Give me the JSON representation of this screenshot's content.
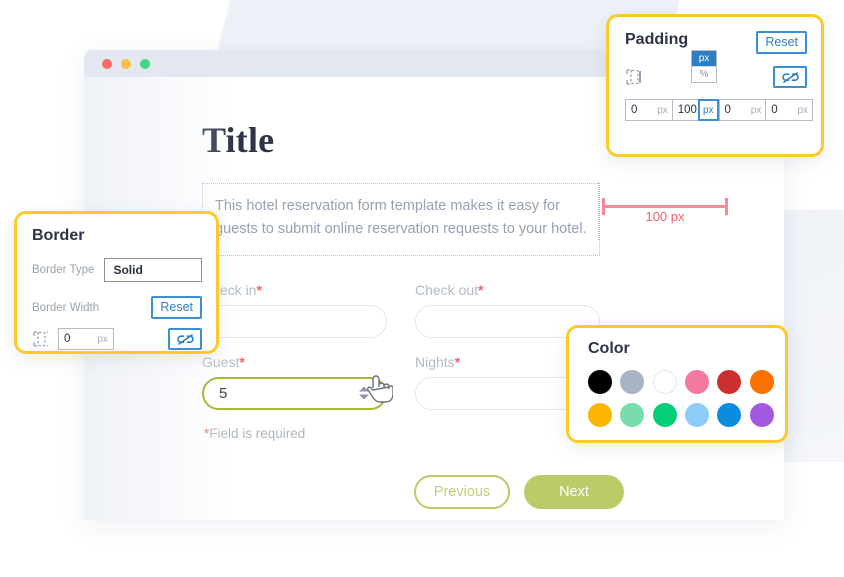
{
  "browser": {
    "dots": [
      "red",
      "amber",
      "green"
    ]
  },
  "form": {
    "title": "Title",
    "description": "This hotel reservation form template makes it easy for guests to submit online reservation requests to your hotel.",
    "fields": [
      {
        "label": "Check in",
        "required": true,
        "value": ""
      },
      {
        "label": "Check out",
        "required": true,
        "value": ""
      },
      {
        "label": "Guest",
        "required": true,
        "value": "5"
      },
      {
        "label": "Nights",
        "required": true,
        "value": ""
      }
    ],
    "error_message": "Field is required",
    "error_star": "*",
    "required_mark": "*",
    "buttons": {
      "previous": "Previous",
      "next": "Next"
    }
  },
  "measurement": {
    "label": "100 px"
  },
  "padding_panel": {
    "title": "Padding",
    "reset_label": "Reset",
    "link_icon": "unlink-icon",
    "box_icon": "padding-box-icon",
    "values": [
      {
        "num": "0",
        "unit": "px"
      },
      {
        "num": "100",
        "unit": "px"
      },
      {
        "num": "0",
        "unit": "px"
      },
      {
        "num": "0",
        "unit": "px"
      }
    ],
    "unit_menu": {
      "selected": "px",
      "other": "%"
    }
  },
  "border_panel": {
    "title": "Border",
    "type_label": "Border Type",
    "type_value": "Solid",
    "width_label": "Border Width",
    "reset_label": "Reset",
    "width_value": "0",
    "width_unit": "px",
    "link_icon": "unlink-icon",
    "box_icon": "border-box-icon"
  },
  "color_panel": {
    "title": "Color",
    "swatches": [
      {
        "name": "black",
        "hex": "#000000"
      },
      {
        "name": "grey",
        "hex": "#a7b4c4"
      },
      {
        "name": "white",
        "hex": "#ffffff"
      },
      {
        "name": "pink",
        "hex": "#f4799f"
      },
      {
        "name": "red",
        "hex": "#cd2e2e"
      },
      {
        "name": "orange",
        "hex": "#fb7100"
      },
      {
        "name": "amber",
        "hex": "#fcb700"
      },
      {
        "name": "mint",
        "hex": "#79dcab"
      },
      {
        "name": "green",
        "hex": "#06cd77"
      },
      {
        "name": "light-blue",
        "hex": "#8ecdfa"
      },
      {
        "name": "blue",
        "hex": "#0a8cdf"
      },
      {
        "name": "purple",
        "hex": "#a358e0"
      }
    ]
  },
  "colors": {
    "panel_border": "#fccb2a",
    "accent_blue": "#2d7fc4",
    "button_green": "#bcca67",
    "required_red": "#f4606c",
    "measure_pink": "#f78a95"
  }
}
